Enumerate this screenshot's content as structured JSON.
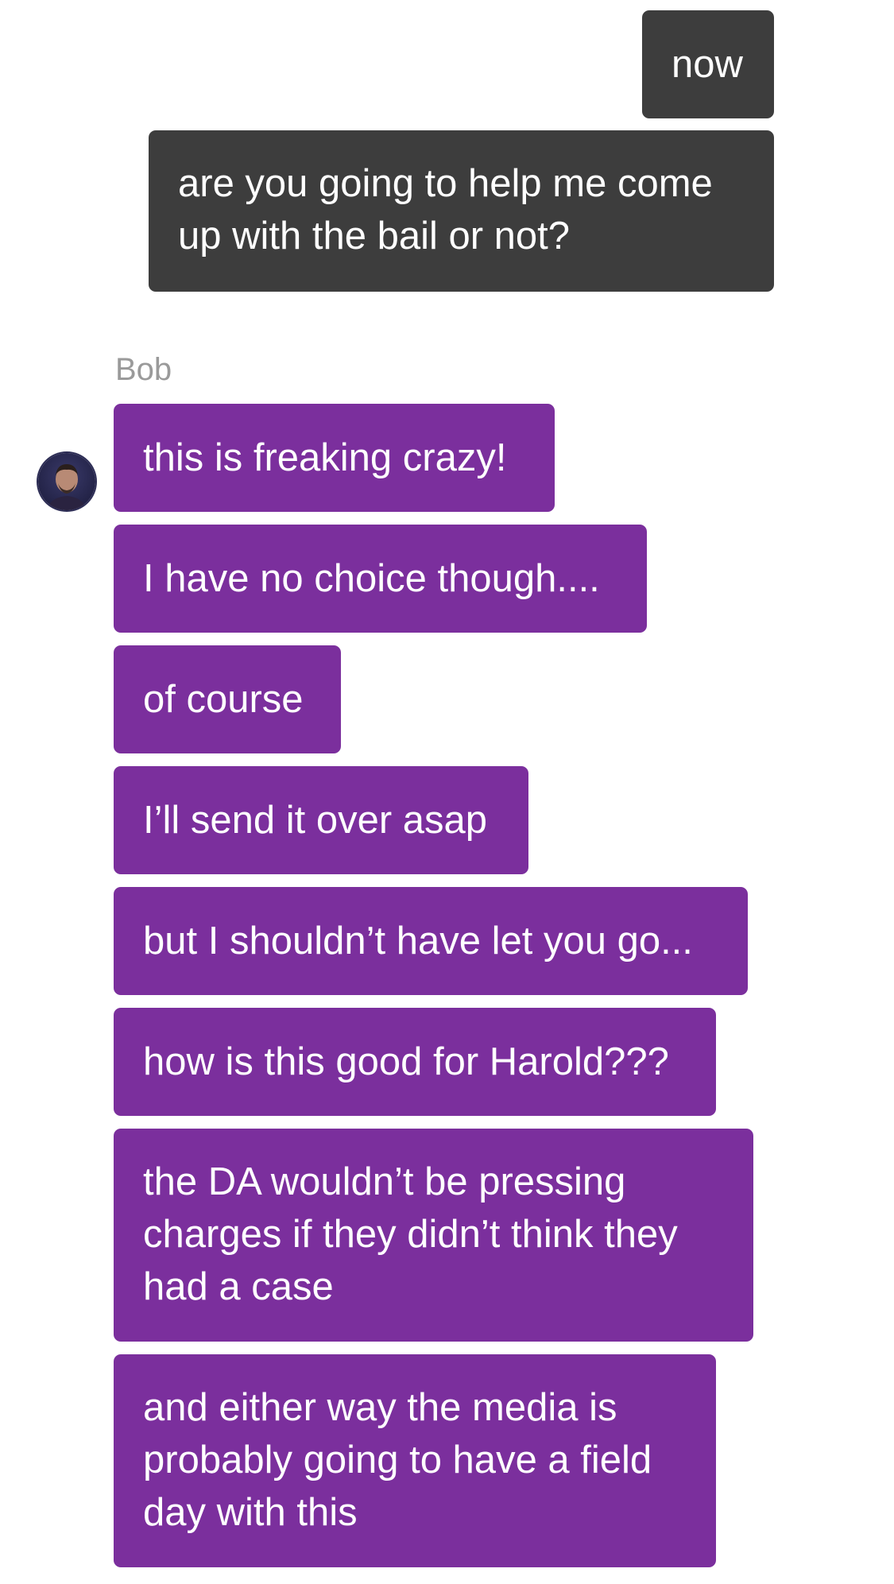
{
  "conversation": {
    "outgoing": [
      {
        "text": "now"
      },
      {
        "text": "are you going to help me come up with the bail or not?"
      }
    ],
    "contact": {
      "name": "Bob",
      "avatar_icon": "person-avatar-icon"
    },
    "incoming": [
      {
        "text": "this is freaking crazy!"
      },
      {
        "text": "I have no choice though...."
      },
      {
        "text": "of course"
      },
      {
        "text": "I’ll send it over asap"
      },
      {
        "text": "but I shouldn’t have let you go..."
      },
      {
        "text": "how is this good for Harold???"
      },
      {
        "text": "the DA wouldn’t be pressing charges if they didn’t think they had a case"
      },
      {
        "text": "and either way the media is probably going to have a field day with this"
      }
    ]
  },
  "colors": {
    "outgoing_bubble": "#3d3d3d",
    "incoming_bubble": "#7b2f9d",
    "sender_name": "#9a9a9a",
    "background": "#ffffff"
  }
}
